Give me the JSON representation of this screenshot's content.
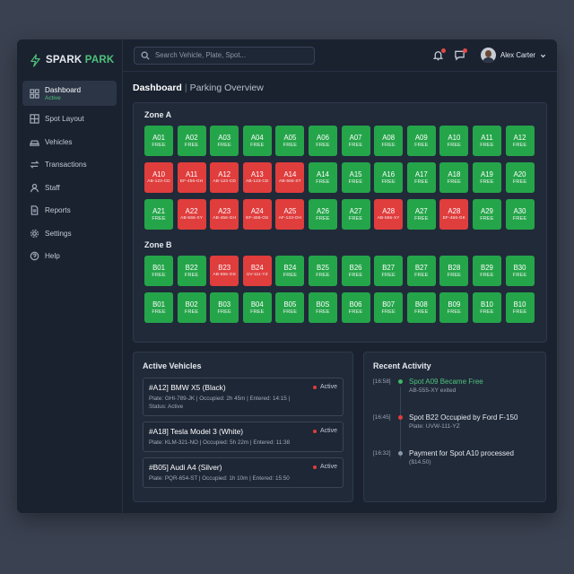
{
  "brand": {
    "name_part1": "SPARK",
    "name_part2": " PARK",
    "accent": "#4ec27a"
  },
  "sidebar": {
    "items": [
      {
        "key": "dashboard",
        "label": "Dashboard",
        "sub": "Active",
        "icon": "dashboard-icon",
        "active": true
      },
      {
        "key": "spot-layout",
        "label": "Spot Layout",
        "icon": "grid-icon"
      },
      {
        "key": "vehicles",
        "label": "Vehicles",
        "icon": "car-icon"
      },
      {
        "key": "transactions",
        "label": "Transactions",
        "icon": "swap-icon"
      },
      {
        "key": "staff",
        "label": "Staff",
        "icon": "user-icon"
      },
      {
        "key": "reports",
        "label": "Reports",
        "icon": "document-icon"
      },
      {
        "key": "settings",
        "label": "Settings",
        "icon": "gear-icon"
      },
      {
        "key": "help",
        "label": "Help",
        "icon": "help-icon"
      }
    ]
  },
  "topbar": {
    "search_placeholder": "Search Vehicle, Plate, Spot...",
    "user_name": "Alex Carter"
  },
  "page": {
    "title": "Dashboard",
    "separator": "|",
    "subtitle": "Parking Overview"
  },
  "zones": [
    {
      "title": "Zone A",
      "spots": [
        {
          "id": "A01",
          "status": "FREE"
        },
        {
          "id": "A02",
          "status": "FREE"
        },
        {
          "id": "A03",
          "status": "FREE"
        },
        {
          "id": "A04",
          "status": "FREE"
        },
        {
          "id": "A05",
          "status": "FREE"
        },
        {
          "id": "A06",
          "status": "FREE"
        },
        {
          "id": "A07",
          "status": "FREE"
        },
        {
          "id": "A08",
          "status": "FREE"
        },
        {
          "id": "A09",
          "status": "FREE"
        },
        {
          "id": "A10",
          "status": "FREE"
        },
        {
          "id": "A11",
          "status": "FREE"
        },
        {
          "id": "A12",
          "status": "FREE"
        },
        {
          "id": "A10",
          "status": "AB-123-CD",
          "occupied": true
        },
        {
          "id": "A11",
          "status": "EF-456-GH",
          "occupied": true
        },
        {
          "id": "A12",
          "status": "AB-123-CD",
          "occupied": true
        },
        {
          "id": "A13",
          "status": "AB-123-CD",
          "occupied": true
        },
        {
          "id": "A14",
          "status": "AB-555-ST",
          "occupied": true
        },
        {
          "id": "A14",
          "status": "FREE"
        },
        {
          "id": "A15",
          "status": "FREE"
        },
        {
          "id": "A16",
          "status": "FREE"
        },
        {
          "id": "A17",
          "status": "FREE"
        },
        {
          "id": "A18",
          "status": "FREE"
        },
        {
          "id": "A19",
          "status": "FREE"
        },
        {
          "id": "A20",
          "status": "FREE"
        },
        {
          "id": "A21",
          "status": "FREE"
        },
        {
          "id": "A22",
          "status": "AB-555-XY",
          "occupied": true
        },
        {
          "id": "A23",
          "status": "AB-456-GH",
          "occupied": true
        },
        {
          "id": "A24",
          "status": "EF-456-OS",
          "occupied": true
        },
        {
          "id": "A25",
          "status": "AF-123-OH",
          "occupied": true
        },
        {
          "id": "A26",
          "status": "FREE"
        },
        {
          "id": "A27",
          "status": "FREE"
        },
        {
          "id": "A28",
          "status": "AB-555-XY",
          "occupied": true
        },
        {
          "id": "A27",
          "status": "FREE"
        },
        {
          "id": "A28",
          "status": "EF-456-GK",
          "occupied": true
        },
        {
          "id": "A29",
          "status": "FREE"
        },
        {
          "id": "A30",
          "status": "FREE"
        }
      ]
    },
    {
      "title": "Zone B",
      "spots": [
        {
          "id": "B01",
          "status": "FREE"
        },
        {
          "id": "B22",
          "status": "FREE"
        },
        {
          "id": "B23",
          "status": "AB-555-OS",
          "occupied": true
        },
        {
          "id": "B24",
          "status": "UV-111-YZ",
          "occupied": true
        },
        {
          "id": "B24",
          "status": "FREE"
        },
        {
          "id": "B25",
          "status": "FREE"
        },
        {
          "id": "B26",
          "status": "FREE"
        },
        {
          "id": "B27",
          "status": "FREE"
        },
        {
          "id": "B27",
          "status": "FREE"
        },
        {
          "id": "B28",
          "status": "FREE"
        },
        {
          "id": "B29",
          "status": "FREE"
        },
        {
          "id": "B30",
          "status": "FREE"
        },
        {
          "id": "B01",
          "status": "FREE"
        },
        {
          "id": "B02",
          "status": "FREE"
        },
        {
          "id": "B03",
          "status": "FREE"
        },
        {
          "id": "B04",
          "status": "FREE"
        },
        {
          "id": "B05",
          "status": "FREE"
        },
        {
          "id": "B0S",
          "status": "FREE"
        },
        {
          "id": "B06",
          "status": "FREE"
        },
        {
          "id": "B07",
          "status": "FREE"
        },
        {
          "id": "B08",
          "status": "FREE"
        },
        {
          "id": "B09",
          "status": "FREE"
        },
        {
          "id": "B10",
          "status": "FREE"
        },
        {
          "id": "B10",
          "status": "FREE"
        }
      ]
    }
  ],
  "active_vehicles": {
    "title": "Active Vehicles",
    "items": [
      {
        "head": "#A12] BMW X5 (Black)",
        "status": "Active",
        "line1": "Plate: GHI-789-JK | Occupied: 2h 45m | Entered: 14:15 |",
        "line2": "Status: Active"
      },
      {
        "head": "#A18] Tesla Model 3 (White)",
        "status": "Active",
        "line1": "Plate: KLM-321-NO | Occupied: 5h 22m | Entered: 11:38",
        "line2": ""
      },
      {
        "head": "#B05] Audi A4 (Silver)",
        "status": "Active",
        "line1": "Plate: PQR-654-ST | Occupied: 1h 10m | Entered: 15:50",
        "line2": ""
      }
    ]
  },
  "recent_activity": {
    "title": "Recent Activity",
    "items": [
      {
        "time": "[16:58]",
        "title": "Spot A09 Became Free",
        "sub": "AB-555-XY exited",
        "color": "#3fb865",
        "green": true
      },
      {
        "time": "[16:45]",
        "title": "Spot B22 Occupied by Ford F-150",
        "sub": "Plate: UVW-111-YZ",
        "color": "#e03d3d"
      },
      {
        "time": "[16:32]",
        "title": "Payment for Spot A10 processed",
        "sub": "($14.50)",
        "color": "#8d96a6"
      }
    ]
  }
}
